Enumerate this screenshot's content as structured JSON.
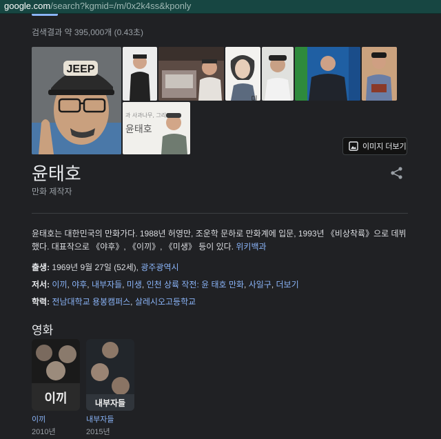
{
  "browser": {
    "url_host": "google.com",
    "url_path": "/search?kgmid=/m/0x2k4ss&kponly"
  },
  "result_stats": "검색결과 약 395,000개 (0.43초)",
  "images": {
    "more_label": "이미지 더보기",
    "thumb_overlay_text": "과 사과나무, 그리고 윤태호",
    "cap_text": "JEEP",
    "tile_text": "미생"
  },
  "entity": {
    "title": "윤태호",
    "subtitle": "만화 제작자"
  },
  "description": {
    "text": "윤태호는 대한민국의 만화가다. 1988년 허영만, 조운학 문하로 만화계에 입문, 1993년 《비상착륙》으로 데뷔했다. 대표작으로 《야후》, 《이끼》, 《미생》 등이 있다.",
    "source": "위키백과"
  },
  "facts": {
    "birth": {
      "label": "출생:",
      "value": "1969년 9월 27일 (52세),",
      "place": "광주광역시"
    },
    "works": {
      "label": "저서:",
      "items": [
        "이끼",
        "야후",
        "내부자들",
        "미생",
        "인천 상륙 작전: 윤 태호 만화",
        "사일구"
      ],
      "more": "더보기"
    },
    "education": {
      "label": "학력:",
      "items": [
        "전남대학교 용봉캠퍼스",
        "살레시오고등학교"
      ]
    }
  },
  "movies": {
    "heading": "영화",
    "items": [
      {
        "title": "이끼",
        "year": "2010년",
        "poster_text": "이끼"
      },
      {
        "title": "내부자들",
        "year": "2015년",
        "poster_text": "내부자들"
      }
    ]
  },
  "colors": {
    "background": "#202124",
    "link": "#8ab4f8",
    "url_bar": "#174642"
  }
}
